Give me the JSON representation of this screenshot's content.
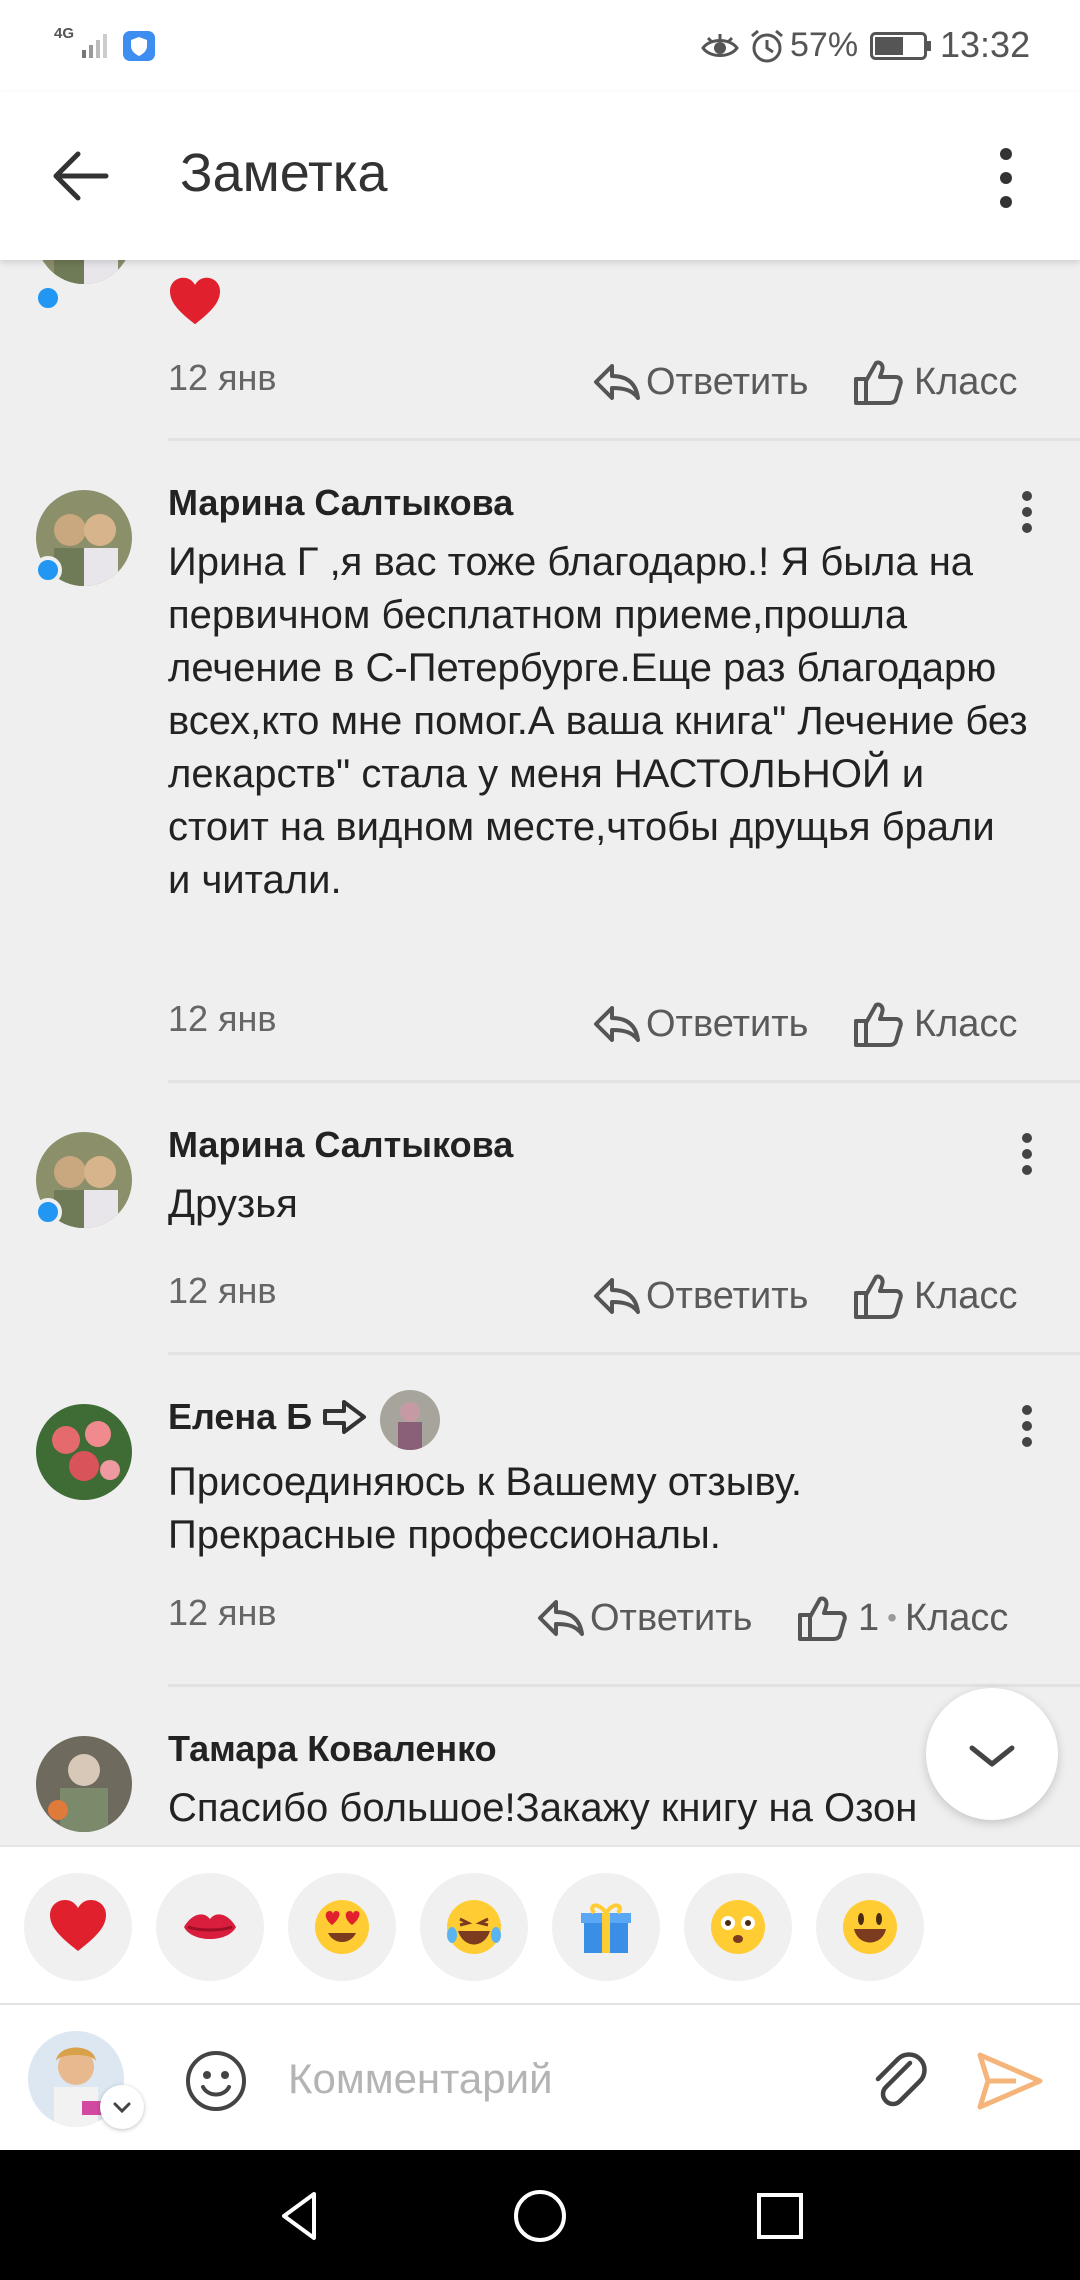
{
  "status_bar": {
    "network": "4G",
    "battery": "57%",
    "time": "13:32"
  },
  "header": {
    "title": "Заметка"
  },
  "comments": [
    {
      "author": "",
      "text": "",
      "date": "12 янв",
      "reply": "Ответить",
      "like": "Класс"
    },
    {
      "author": "Марина Салтыкова",
      "text": "Ирина Г ,я вас тоже благодарю.! Я была на первичном бесплатном приеме,прошла лечение в С-Петербурге.Еще раз благодарю всех,кто мне помог.А ваша книга\" Лечение без лекарств\" стала у меня НАСТОЛЬНОЙ и стоит на видном месте,чтобы друщья брали и читали.",
      "date": "12 янв",
      "reply": "Ответить",
      "like": "Класс"
    },
    {
      "author": "Марина Салтыкова",
      "text": "Друзья",
      "date": "12 янв",
      "reply": "Ответить",
      "like": "Класс"
    },
    {
      "author": "Елена Б",
      "text": "Присоединяюсь к Вашему отзыву. Прекрасные профессионалы.",
      "date": "12 янв",
      "reply": "Ответить",
      "like_count": "1",
      "like_sep": "•",
      "like": "Класс"
    },
    {
      "author": "Тамара Коваленко",
      "text": "Спасибо большое!Закажу книгу на Озон"
    }
  ],
  "emoji_tray": [
    "heart-emoji",
    "kiss-emoji",
    "heart-eyes-emoji",
    "laughing-tears-emoji",
    "gift-emoji",
    "flushed-emoji",
    "smiley-emoji"
  ],
  "input": {
    "placeholder": "Комментарий"
  },
  "colors": {
    "accent_send": "#f5b57a",
    "online_dot": "#2196f3",
    "heart": "#e0212d"
  }
}
